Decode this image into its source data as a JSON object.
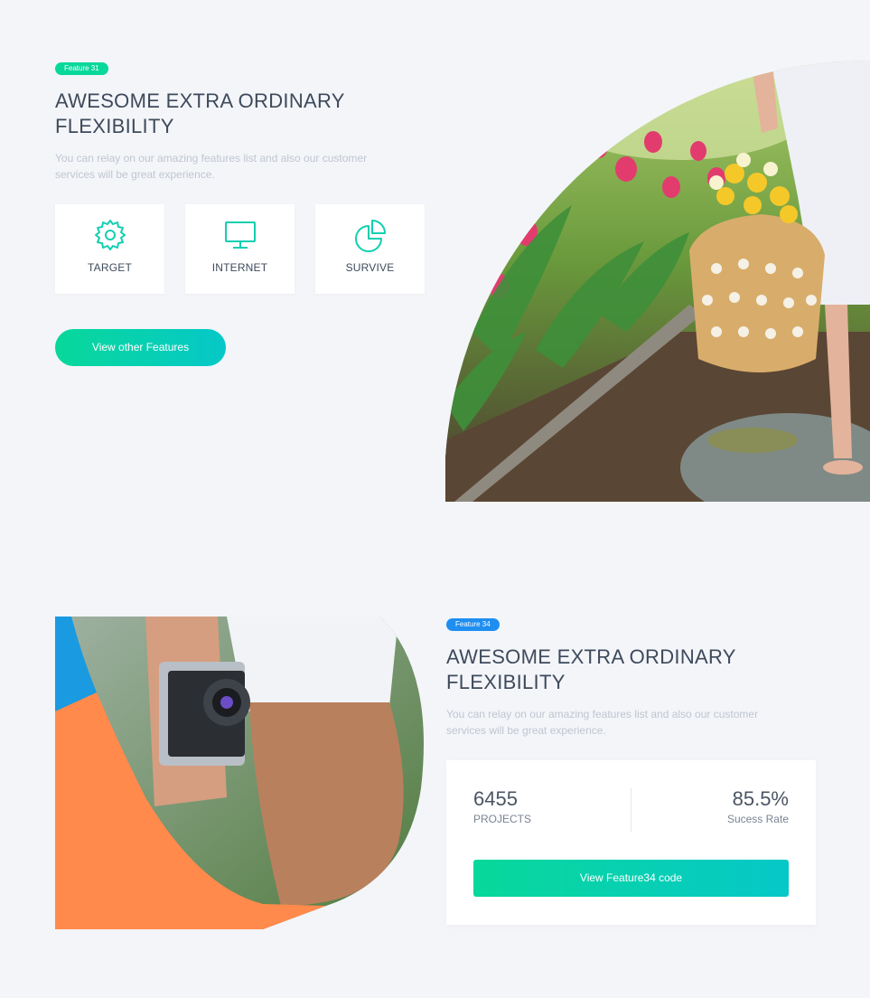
{
  "colors": {
    "accent_green": "#08d89a",
    "accent_cyan": "#06c8c8",
    "badge_blue": "#1f8ef1",
    "title": "#3e4a5b",
    "muted": "#c0c6d0",
    "orange": "#ff8a4c"
  },
  "feature31": {
    "badge": "Feature 31",
    "title_line1": "AWESOME EXTRA ORDINARY",
    "title_line2": "FLEXIBILITY",
    "desc_line1": "You can relay on our amazing features list and also our customer",
    "desc_line2": "services will be great experience.",
    "cards": [
      {
        "label": "TARGET",
        "icon": "gear-icon"
      },
      {
        "label": "INTERNET",
        "icon": "monitor-icon"
      },
      {
        "label": "SURVIVE",
        "icon": "pie-chart-icon"
      }
    ],
    "cta": "View other Features",
    "image": "flowers-basket-photo"
  },
  "feature34": {
    "badge": "Feature 34",
    "title_line1": "AWESOME EXTRA ORDINARY",
    "title_line2": "FLEXIBILITY",
    "desc_line1": "You can relay on our amazing features list and also our customer",
    "desc_line2": "services will be great experience.",
    "stats": [
      {
        "value": "6455",
        "label": "PROJECTS"
      },
      {
        "value": "85.5%",
        "label": "Sucess Rate"
      }
    ],
    "cta": "View Feature34 code",
    "image": "camera-photo"
  }
}
